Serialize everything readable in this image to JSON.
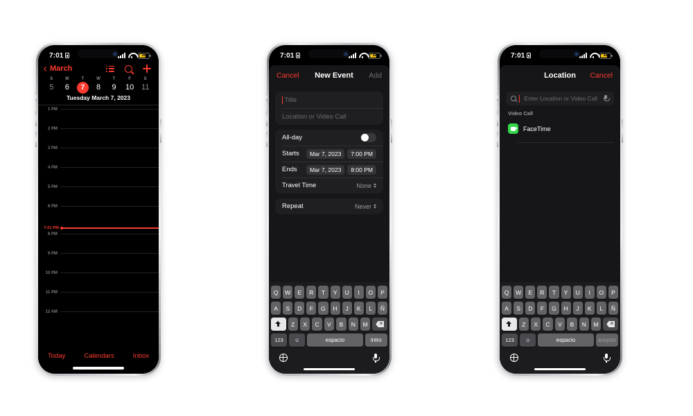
{
  "statusbar": {
    "time": "7:01",
    "lock_icon": "lock-icon",
    "battery_level": "10",
    "signal_icon": "cellular-signal-icon",
    "wifi_icon": "wifi-icon"
  },
  "phone1": {
    "nav": {
      "back_label": "March",
      "list_icon": "list-view-icon",
      "search_icon": "search-icon",
      "add_icon": "plus-icon"
    },
    "weekdays": [
      "S",
      "M",
      "T",
      "W",
      "T",
      "F",
      "S"
    ],
    "days": [
      {
        "n": "5",
        "state": "muted"
      },
      {
        "n": "6",
        "state": "normal"
      },
      {
        "n": "7",
        "state": "today"
      },
      {
        "n": "8",
        "state": "normal"
      },
      {
        "n": "9",
        "state": "normal"
      },
      {
        "n": "10",
        "state": "normal"
      },
      {
        "n": "11",
        "state": "muted"
      }
    ],
    "day_label": "Tuesday   March 7, 2023",
    "hours": [
      "1 PM",
      "2 PM",
      "3 PM",
      "4 PM",
      "5 PM",
      "6 PM",
      "8 PM",
      "9 PM",
      "10 PM",
      "11 PM",
      "12 AM"
    ],
    "now_label": "7:01 PM",
    "tabs": [
      "Today",
      "Calendars",
      "Inbox"
    ]
  },
  "phone2": {
    "nav": {
      "cancel": "Cancel",
      "title": "New Event",
      "add": "Add"
    },
    "title_placeholder": "Title",
    "location_placeholder": "Location or Video Call",
    "allday_label": "All-day",
    "starts": {
      "label": "Starts",
      "date": "Mar 7, 2023",
      "time": "7:00 PM"
    },
    "ends": {
      "label": "Ends",
      "date": "Mar 7, 2023",
      "time": "8:00 PM"
    },
    "travel": {
      "label": "Travel Time",
      "value": "None"
    },
    "repeat": {
      "label": "Repeat",
      "value": "Never"
    }
  },
  "phone3": {
    "nav": {
      "title": "Location",
      "cancel": "Cancel"
    },
    "search_placeholder": "Enter Location or Video Call",
    "section_header": "Video Call",
    "facetime_label": "FaceTime"
  },
  "keyboard": {
    "row1": [
      "Q",
      "W",
      "E",
      "R",
      "T",
      "Y",
      "U",
      "I",
      "O",
      "P"
    ],
    "row2": [
      "A",
      "S",
      "D",
      "F",
      "G",
      "H",
      "J",
      "K",
      "L",
      "Ñ"
    ],
    "row3": [
      "Z",
      "X",
      "C",
      "V",
      "B",
      "N",
      "M"
    ],
    "shift_icon": "shift-icon",
    "delete_icon": "delete-icon",
    "numbers_key": "123",
    "emoji_icon": "emoji-icon",
    "space_key": "espacio",
    "return_key_phone2": "intro",
    "return_key_phone3": "aceptar",
    "globe_icon": "globe-icon",
    "dictation_icon": "microphone-icon"
  },
  "colors": {
    "accent_red": "#ff3b30",
    "facetime_green": "#32d74b",
    "battery_yellow": "#f5c518"
  }
}
